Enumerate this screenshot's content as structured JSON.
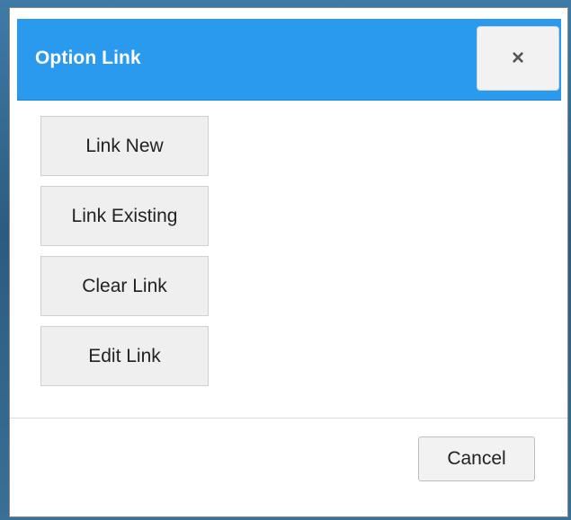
{
  "dialog": {
    "title": "Option Link",
    "close_icon": "close-icon",
    "close_glyph": "×"
  },
  "options": [
    {
      "label": "Link New"
    },
    {
      "label": "Link Existing"
    },
    {
      "label": "Clear Link"
    },
    {
      "label": "Edit Link"
    }
  ],
  "footer": {
    "cancel_label": "Cancel"
  },
  "colors": {
    "header": "#2a9aef",
    "button_bg": "#efefef",
    "page_bg": "#2b5f86"
  }
}
